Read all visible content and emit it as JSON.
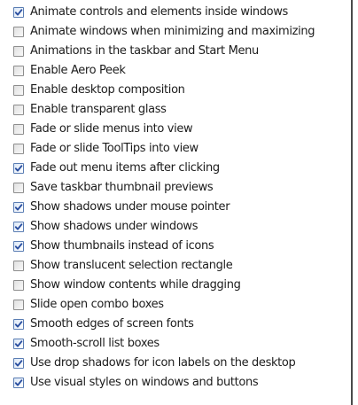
{
  "options": [
    {
      "label": "Animate controls and elements inside windows",
      "checked": true
    },
    {
      "label": "Animate windows when minimizing and maximizing",
      "checked": false
    },
    {
      "label": "Animations in the taskbar and Start Menu",
      "checked": false
    },
    {
      "label": "Enable Aero Peek",
      "checked": false
    },
    {
      "label": "Enable desktop composition",
      "checked": false
    },
    {
      "label": "Enable transparent glass",
      "checked": false
    },
    {
      "label": "Fade or slide menus into view",
      "checked": false
    },
    {
      "label": "Fade or slide ToolTips into view",
      "checked": false
    },
    {
      "label": "Fade out menu items after clicking",
      "checked": true
    },
    {
      "label": "Save taskbar thumbnail previews",
      "checked": false
    },
    {
      "label": "Show shadows under mouse pointer",
      "checked": true
    },
    {
      "label": "Show shadows under windows",
      "checked": true
    },
    {
      "label": "Show thumbnails instead of icons",
      "checked": true
    },
    {
      "label": "Show translucent selection rectangle",
      "checked": false
    },
    {
      "label": "Show window contents while dragging",
      "checked": false
    },
    {
      "label": "Slide open combo boxes",
      "checked": false
    },
    {
      "label": "Smooth edges of screen fonts",
      "checked": true
    },
    {
      "label": "Smooth-scroll list boxes",
      "checked": true
    },
    {
      "label": "Use drop shadows for icon labels on the desktop",
      "checked": true
    },
    {
      "label": "Use visual styles on windows and buttons",
      "checked": true
    }
  ],
  "colors": {
    "check_mark": "#2a4fa0",
    "text": "#1c1c1c"
  }
}
